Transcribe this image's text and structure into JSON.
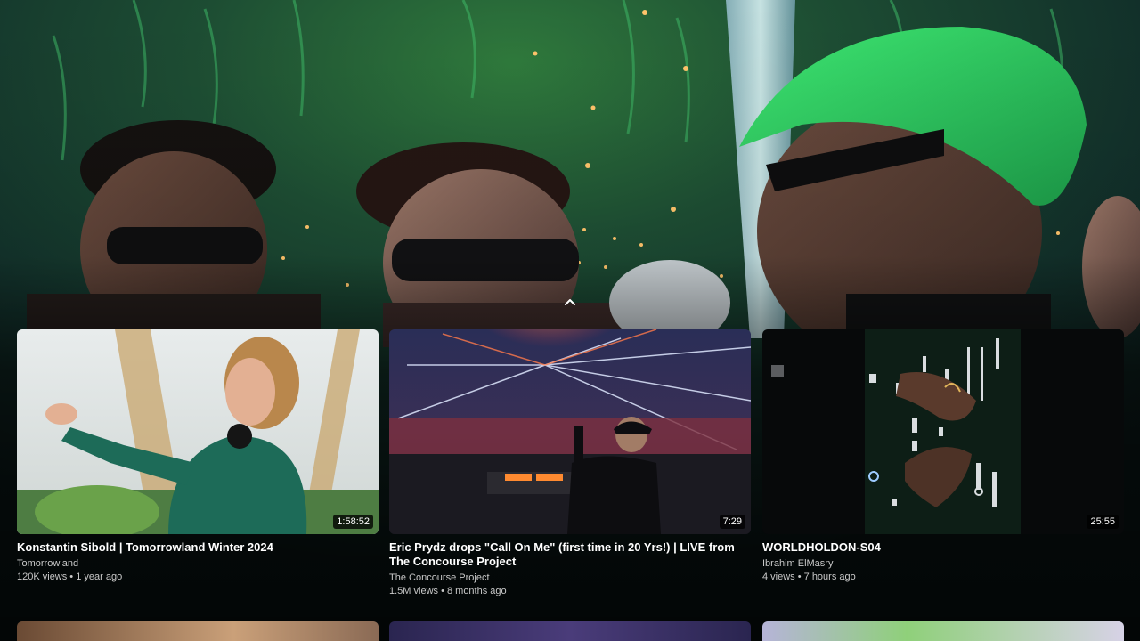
{
  "player": {
    "collapse_icon": "chevron-up-icon"
  },
  "related": [
    {
      "title": "Konstantin Sibold | Tomorrowland Winter 2024",
      "channel": "Tomorrowland",
      "meta": "120K views • 1 year ago",
      "duration": "1:58:52"
    },
    {
      "title": "Eric Prydz drops \"Call On Me\" (first time in 20 Yrs!) | LIVE from The Concourse Project",
      "channel": "The Concourse Project",
      "meta": "1.5M views • 8 months ago",
      "duration": "7:29"
    },
    {
      "title": "WORLDHOLDON-S04",
      "channel": "Ibrahim ElMasry",
      "meta": "4 views • 7 hours ago",
      "duration": "25:55"
    }
  ]
}
